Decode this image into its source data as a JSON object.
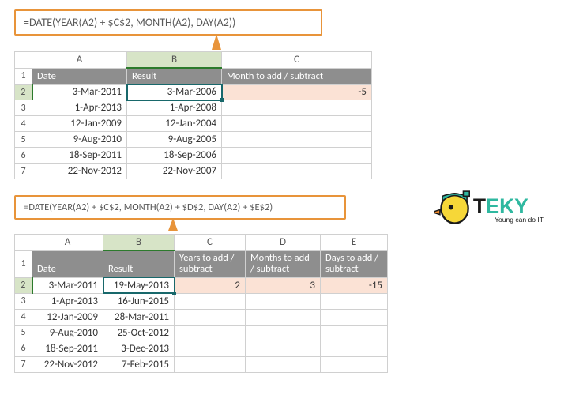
{
  "top": {
    "formula": "=DATE(YEAR(A2) + $C$2, MONTH(A2), DAY(A2))",
    "cols": {
      "a": "A",
      "b": "B",
      "c": "C"
    },
    "rows": [
      "1",
      "2",
      "3",
      "4",
      "5",
      "6",
      "7"
    ],
    "headers": {
      "date": "Date",
      "result": "Result",
      "month": "Month to add / subtract"
    },
    "data": [
      {
        "date": "3-Mar-2011",
        "result": "3-Mar-2006"
      },
      {
        "date": "1-Apr-2013",
        "result": "1-Apr-2008"
      },
      {
        "date": "12-Jan-2009",
        "result": "12-Jan-2004"
      },
      {
        "date": "9-Aug-2010",
        "result": "9-Aug-2005"
      },
      {
        "date": "18-Sep-2011",
        "result": "18-Sep-2006"
      },
      {
        "date": "22-Nov-2012",
        "result": "22-Nov-2007"
      }
    ],
    "c2": "-5"
  },
  "bottom": {
    "formula": "=DATE(YEAR(A2) + $C$2, MONTH(A2) + $D$2, DAY(A2) + $E$2)",
    "cols": {
      "a": "A",
      "b": "B",
      "c": "C",
      "d": "D",
      "e": "E"
    },
    "rows": [
      "1",
      "2",
      "3",
      "4",
      "5",
      "6",
      "7"
    ],
    "headers": {
      "date": "Date",
      "result": "Result",
      "years": "Years to add / subtract",
      "months": "Months to add / subtract",
      "days": "Days to add / subtract"
    },
    "data": [
      {
        "date": "3-Mar-2011",
        "result": "19-May-2013"
      },
      {
        "date": "1-Apr-2013",
        "result": "16-Jun-2015"
      },
      {
        "date": "12-Jan-2009",
        "result": "28-Mar-2011"
      },
      {
        "date": "9-Aug-2010",
        "result": "25-Oct-2012"
      },
      {
        "date": "18-Sep-2011",
        "result": "3-Dec-2013"
      },
      {
        "date": "22-Nov-2012",
        "result": "7-Feb-2015"
      }
    ],
    "c2": "2",
    "d2": "3",
    "e2": "-15"
  },
  "logo": {
    "text": "TEKY",
    "tag": "Young can do IT"
  }
}
